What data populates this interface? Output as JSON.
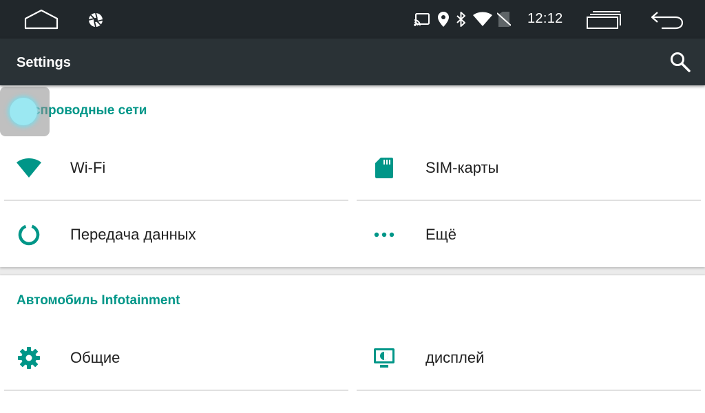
{
  "status_bar": {
    "time": "12:12",
    "icons": [
      "home-icon",
      "aperture-icon",
      "cast-icon",
      "location-icon",
      "bluetooth-icon",
      "wifi-signal-icon",
      "no-sim-icon",
      "recent-apps-icon",
      "back-icon"
    ]
  },
  "app_bar": {
    "title": "Settings",
    "search_icon": "search-icon"
  },
  "sections": [
    {
      "title": "Беспроводные сети",
      "items": [
        {
          "label": "Wi-Fi",
          "icon": "wifi-icon"
        },
        {
          "label": "SIM-карты",
          "icon": "sim-card-icon"
        },
        {
          "label": "Передача данных",
          "icon": "data-usage-icon"
        },
        {
          "label": "Ещё",
          "icon": "more-icon"
        }
      ]
    },
    {
      "title": "Автомобиль Infotainment",
      "items": [
        {
          "label": "Общие",
          "icon": "gear-icon"
        },
        {
          "label": "дисплей",
          "icon": "display-icon"
        }
      ]
    }
  ],
  "colors": {
    "accent": "#009688",
    "status_bar": "#21272b",
    "app_bar": "#2a3236",
    "text": "#212121",
    "background": "#ffffff"
  }
}
